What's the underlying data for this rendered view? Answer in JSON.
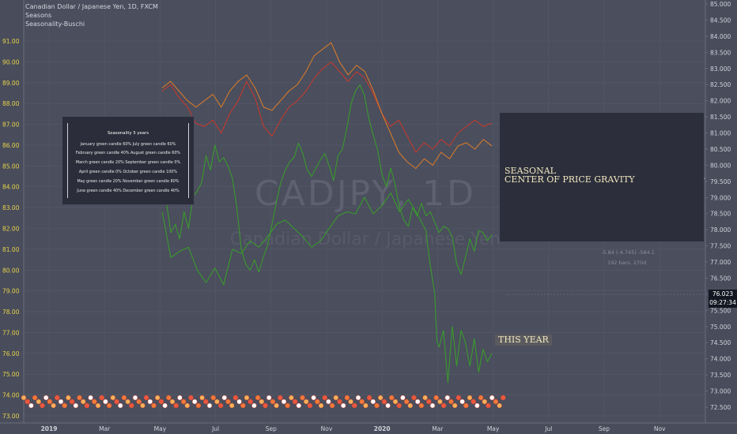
{
  "header": {
    "symbol_line": "Canadian Dollar / Japanese Yen, 1D, FXCM",
    "indicator_1": "Seasons",
    "indicator_2": "Seasonality-Buschi"
  },
  "watermark": {
    "ticker": "CADJPY, 1D",
    "name": "Canadian Dollar / Japanese Yen"
  },
  "seasonality_panel": {
    "title": "Seasonality 5 years",
    "rows": [
      "January green candle 60%    July green candle 60%",
      "February green candle 40%    August green candle 60%",
      "March green candle 20%    September green candle 0%",
      "April green candle 0%    October green candle 100%",
      "May green candle 20%    November green candle 80%",
      "June green candle 40%    December green candle 40%"
    ]
  },
  "annotations": {
    "seasonal_line1": "SEASONAL",
    "seasonal_line2": "CENTER OF PRICE GRAVITY",
    "this_year": "THIS YEAR",
    "measure_line1": "-5.84 (-4.745) -584.1",
    "measure_line2": "192 bars, 270d"
  },
  "price_tags": {
    "last_price": "76.023",
    "countdown": "09:27:34"
  },
  "colors": {
    "background": "#4a4e5d",
    "price_line": "#3a9a2c",
    "red_line": "#c23a2e",
    "orange_line": "#d4792a",
    "axis_text_left": "#e8d34a",
    "axis_text_right": "#d0d3d9"
  },
  "chart_data": {
    "type": "line",
    "left_axis": {
      "ticks": [
        "73.00",
        "74.00",
        "75.00",
        "76.00",
        "77.00",
        "78.00",
        "79.00",
        "80.00",
        "81.00",
        "82.00",
        "83.00",
        "84.00",
        "85.00",
        "86.00",
        "87.00",
        "88.00",
        "89.00",
        "90.00",
        "91.00"
      ],
      "ylim": [
        73.0,
        91.0
      ]
    },
    "right_axis": {
      "ticks": [
        "72.500",
        "73.000",
        "73.500",
        "74.000",
        "74.500",
        "75.000",
        "75.500",
        "76.000",
        "76.500",
        "77.000",
        "77.500",
        "78.000",
        "78.500",
        "79.000",
        "79.500",
        "80.000",
        "80.500",
        "81.000",
        "81.500",
        "82.000",
        "82.500",
        "83.000",
        "83.500",
        "84.000",
        "84.500",
        "85.000"
      ],
      "ylim": [
        72.5,
        85.0
      ]
    },
    "x_ticks": [
      "2019",
      "Mar",
      "May",
      "Jul",
      "Sep",
      "Nov",
      "2020",
      "Mar",
      "May",
      "Jul",
      "Sep",
      "Nov"
    ],
    "series": [
      {
        "color": "red",
        "axis": "right",
        "points": [
          [
            0,
            82.3
          ],
          [
            0.3,
            82.5
          ],
          [
            0.6,
            82.1
          ],
          [
            0.9,
            81.8
          ],
          [
            1.2,
            81.3
          ],
          [
            1.5,
            81.2
          ],
          [
            1.8,
            81.4
          ],
          [
            2.1,
            81.0
          ],
          [
            2.4,
            81.6
          ],
          [
            2.7,
            82.0
          ],
          [
            3.0,
            82.6
          ],
          [
            3.3,
            82.1
          ],
          [
            3.6,
            81.2
          ],
          [
            3.9,
            80.9
          ],
          [
            4.2,
            81.4
          ],
          [
            4.5,
            81.8
          ],
          [
            4.8,
            82.0
          ],
          [
            5.1,
            82.3
          ],
          [
            5.4,
            82.7
          ],
          [
            5.7,
            83.0
          ],
          [
            6.0,
            83.2
          ],
          [
            6.3,
            82.9
          ],
          [
            6.6,
            82.6
          ],
          [
            6.9,
            82.9
          ],
          [
            7.2,
            82.7
          ],
          [
            7.5,
            82.2
          ],
          [
            7.8,
            81.6
          ],
          [
            8.1,
            81.2
          ],
          [
            8.4,
            81.4
          ],
          [
            8.7,
            80.9
          ],
          [
            9.0,
            80.4
          ],
          [
            9.3,
            80.7
          ],
          [
            9.6,
            80.5
          ],
          [
            9.9,
            80.8
          ],
          [
            10.2,
            80.6
          ],
          [
            10.5,
            81.0
          ],
          [
            10.8,
            81.2
          ],
          [
            11.1,
            81.4
          ],
          [
            11.4,
            81.2
          ],
          [
            11.7,
            81.3
          ]
        ]
      },
      {
        "color": "orange",
        "axis": "right",
        "points": [
          [
            0,
            82.4
          ],
          [
            0.3,
            82.6
          ],
          [
            0.6,
            82.3
          ],
          [
            0.9,
            82.0
          ],
          [
            1.2,
            81.8
          ],
          [
            1.5,
            82.0
          ],
          [
            1.8,
            82.2
          ],
          [
            2.1,
            81.8
          ],
          [
            2.4,
            82.3
          ],
          [
            2.7,
            82.6
          ],
          [
            3.0,
            82.8
          ],
          [
            3.3,
            82.4
          ],
          [
            3.6,
            81.8
          ],
          [
            3.9,
            81.7
          ],
          [
            4.2,
            82.0
          ],
          [
            4.5,
            82.3
          ],
          [
            4.8,
            82.5
          ],
          [
            5.1,
            82.9
          ],
          [
            5.4,
            83.4
          ],
          [
            5.7,
            83.6
          ],
          [
            6.0,
            83.8
          ],
          [
            6.3,
            83.2
          ],
          [
            6.6,
            82.8
          ],
          [
            6.9,
            83.1
          ],
          [
            7.2,
            82.9
          ],
          [
            7.5,
            82.3
          ],
          [
            7.8,
            81.6
          ],
          [
            8.1,
            81.0
          ],
          [
            8.4,
            80.4
          ],
          [
            8.7,
            80.1
          ],
          [
            9.0,
            79.9
          ],
          [
            9.3,
            80.2
          ],
          [
            9.6,
            80.0
          ],
          [
            9.9,
            80.4
          ],
          [
            10.2,
            80.2
          ],
          [
            10.5,
            80.6
          ],
          [
            10.8,
            80.7
          ],
          [
            11.1,
            80.5
          ],
          [
            11.4,
            80.8
          ],
          [
            11.7,
            80.6
          ]
        ]
      },
      {
        "color": "green",
        "axis": "left",
        "points": [
          [
            0,
            84.5
          ],
          [
            0.2,
            83.2
          ],
          [
            0.4,
            81.8
          ],
          [
            0.6,
            82.2
          ],
          [
            0.8,
            81.5
          ],
          [
            1.0,
            82.8
          ],
          [
            1.2,
            82.0
          ],
          [
            1.4,
            83.5
          ],
          [
            1.6,
            83.8
          ],
          [
            1.8,
            84.2
          ],
          [
            2.0,
            85.5
          ],
          [
            2.2,
            84.8
          ],
          [
            2.4,
            86.0
          ],
          [
            2.6,
            85.2
          ],
          [
            2.8,
            85.4
          ],
          [
            3.0,
            85.0
          ],
          [
            3.2,
            84.4
          ],
          [
            3.4,
            83.0
          ],
          [
            3.6,
            81.0
          ],
          [
            3.8,
            80.3
          ],
          [
            4.0,
            80.0
          ],
          [
            4.2,
            80.5
          ],
          [
            4.4,
            79.9
          ],
          [
            4.6,
            80.6
          ],
          [
            4.8,
            81.2
          ],
          [
            5.0,
            82.2
          ],
          [
            5.2,
            83.3
          ],
          [
            5.4,
            84.2
          ],
          [
            5.6,
            84.8
          ],
          [
            5.8,
            85.2
          ],
          [
            6.0,
            85.4
          ],
          [
            6.2,
            86.1
          ],
          [
            6.4,
            85.6
          ],
          [
            6.6,
            84.8
          ],
          [
            6.8,
            84.5
          ],
          [
            7.0,
            84.9
          ],
          [
            7.2,
            85.3
          ],
          [
            7.4,
            85.6
          ],
          [
            7.6,
            85.0
          ],
          [
            7.8,
            84.3
          ],
          [
            8.0,
            85.5
          ],
          [
            8.2,
            85.8
          ],
          [
            8.4,
            86.8
          ],
          [
            8.6,
            88.0
          ],
          [
            8.8,
            88.6
          ],
          [
            9.0,
            88.9
          ],
          [
            9.2,
            88.4
          ],
          [
            9.4,
            87.3
          ],
          [
            9.6,
            86.5
          ],
          [
            9.8,
            85.8
          ],
          [
            10.0,
            84.6
          ],
          [
            10.2,
            84.0
          ],
          [
            10.4,
            84.9
          ],
          [
            10.6,
            84.1
          ],
          [
            10.8,
            83.0
          ],
          [
            11.0,
            82.4
          ],
          [
            11.2,
            82.1
          ],
          [
            11.4,
            83.0
          ],
          [
            11.6,
            82.6
          ],
          [
            11.8,
            83.2
          ],
          [
            12.0,
            82.6
          ],
          [
            12.2,
            82.8
          ],
          [
            12.4,
            82.3
          ],
          [
            12.6,
            81.8
          ],
          [
            12.8,
            82.1
          ],
          [
            13.0,
            82.0
          ],
          [
            13.2,
            81.6
          ],
          [
            13.4,
            80.3
          ],
          [
            13.6,
            79.8
          ],
          [
            13.8,
            80.6
          ],
          [
            14.0,
            81.5
          ],
          [
            14.2,
            80.9
          ],
          [
            14.4,
            81.9
          ],
          [
            14.6,
            81.8
          ],
          [
            14.8,
            81.4
          ],
          [
            15.0,
            81.7
          ]
        ]
      },
      {
        "color": "green",
        "axis": "left",
        "points": [
          [
            0,
            82.8
          ],
          [
            0.4,
            80.6
          ],
          [
            0.8,
            80.9
          ],
          [
            1.2,
            81.1
          ],
          [
            1.6,
            80.0
          ],
          [
            2.0,
            79.4
          ],
          [
            2.4,
            80.1
          ],
          [
            2.8,
            79.3
          ],
          [
            3.2,
            81.0
          ],
          [
            3.6,
            80.8
          ],
          [
            4.0,
            81.4
          ],
          [
            4.4,
            81.1
          ],
          [
            4.8,
            81.6
          ],
          [
            5.2,
            82.2
          ],
          [
            5.6,
            82.4
          ],
          [
            6.0,
            82.0
          ],
          [
            6.4,
            81.6
          ],
          [
            6.8,
            81.1
          ],
          [
            7.2,
            81.4
          ],
          [
            7.6,
            82.0
          ],
          [
            8.0,
            82.6
          ],
          [
            8.4,
            82.8
          ],
          [
            8.8,
            82.7
          ],
          [
            9.2,
            83.5
          ],
          [
            9.6,
            82.7
          ],
          [
            10.0,
            83.1
          ],
          [
            10.4,
            83.7
          ],
          [
            10.8,
            82.8
          ],
          [
            11.2,
            83.4
          ],
          [
            11.6,
            82.7
          ],
          [
            12.0,
            81.9
          ],
          [
            12.2,
            80.2
          ],
          [
            12.4,
            78.9
          ],
          [
            12.5,
            76.6
          ],
          [
            12.6,
            76.3
          ],
          [
            12.8,
            77.1
          ],
          [
            13.0,
            74.6
          ],
          [
            13.2,
            77.3
          ],
          [
            13.4,
            75.4
          ],
          [
            13.6,
            77.1
          ],
          [
            13.8,
            76.5
          ],
          [
            14.0,
            75.4
          ],
          [
            14.2,
            76.7
          ],
          [
            14.4,
            75.1
          ],
          [
            14.6,
            76.2
          ],
          [
            14.8,
            75.6
          ],
          [
            15.0,
            76.0
          ]
        ]
      }
    ]
  }
}
